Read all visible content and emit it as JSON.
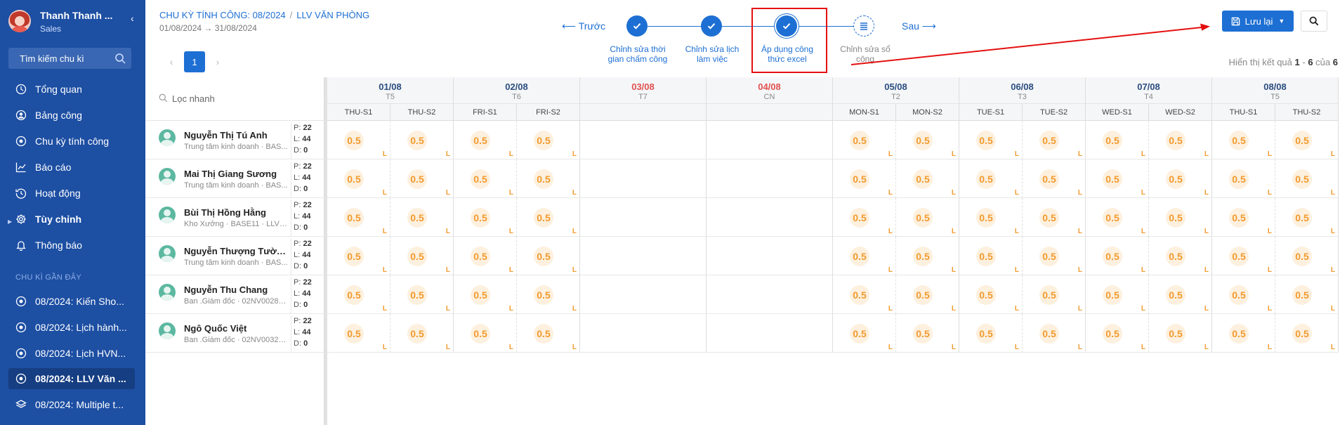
{
  "sidebar": {
    "user_name": "Thanh Thanh ...",
    "user_role": "Sales",
    "search_placeholder": "Tìm kiếm chu kì",
    "items": [
      {
        "label": "Tổng quan",
        "icon": "clock-icon"
      },
      {
        "label": "Bảng công",
        "icon": "user-circle-icon"
      },
      {
        "label": "Chu kỳ tính công",
        "icon": "radio-icon"
      },
      {
        "label": "Báo cáo",
        "icon": "chart-line-icon"
      },
      {
        "label": "Hoạt động",
        "icon": "history-icon"
      },
      {
        "label": "Tùy chỉnh",
        "icon": "gear-icon"
      },
      {
        "label": "Thông báo",
        "icon": "bell-icon"
      }
    ],
    "recent_label": "CHU KÌ GẦN ĐÂY",
    "recent": [
      {
        "label": "08/2024: Kiến Sho..."
      },
      {
        "label": "08/2024: Lịch hành..."
      },
      {
        "label": "08/2024: Lịch HVN..."
      },
      {
        "label": "08/2024: LLV Văn ..."
      },
      {
        "label": "08/2024: Multiple t..."
      }
    ]
  },
  "header": {
    "cycle": "CHU KỲ TÍNH CÔNG: 08/2024",
    "schedule": "LLV VĂN PHÒNG",
    "date_from": "01/08/2024",
    "date_to": "31/08/2024",
    "page": "1",
    "prev_label": "⟵ Trước",
    "next_label": "Sau ⟶"
  },
  "steps": [
    {
      "label": "Chỉnh sửa thời gian chấm công",
      "state": "done"
    },
    {
      "label": "Chỉnh sửa lịch làm việc",
      "state": "done"
    },
    {
      "label": "Áp dụng công thức excel",
      "state": "current"
    },
    {
      "label": "Chỉnh sửa sổ công",
      "state": "pending"
    }
  ],
  "toolbar": {
    "save_label": "Lưu lại",
    "result_prefix": "Hiển thị kết quả",
    "result_from": "1",
    "result_to": "6",
    "result_of": "của",
    "result_total": "6"
  },
  "grid": {
    "quick_filter_placeholder": "Lọc nhanh",
    "days": [
      {
        "date": "01/08",
        "weekday": "T5",
        "off": false,
        "shifts": [
          "THU-S1",
          "THU-S2"
        ]
      },
      {
        "date": "02/08",
        "weekday": "T6",
        "off": false,
        "shifts": [
          "FRI-S1",
          "FRI-S2"
        ]
      },
      {
        "date": "03/08",
        "weekday": "T7",
        "off": true,
        "shifts": []
      },
      {
        "date": "04/08",
        "weekday": "CN",
        "off": true,
        "shifts": []
      },
      {
        "date": "05/08",
        "weekday": "T2",
        "off": false,
        "shifts": [
          "MON-S1",
          "MON-S2"
        ]
      },
      {
        "date": "06/08",
        "weekday": "T3",
        "off": false,
        "shifts": [
          "TUE-S1",
          "TUE-S2"
        ]
      },
      {
        "date": "07/08",
        "weekday": "T4",
        "off": false,
        "shifts": [
          "WED-S1",
          "WED-S2"
        ]
      },
      {
        "date": "08/08",
        "weekday": "T5",
        "off": false,
        "shifts": [
          "THU-S1",
          "THU-S2"
        ]
      }
    ],
    "cell_value": "0.5",
    "cell_flag": "L",
    "employees": [
      {
        "name": "Nguyễn Thị Tú Anh",
        "dept": "Trung tâm kinh doanh · BAS...",
        "p": "22",
        "l": "44",
        "d": "0"
      },
      {
        "name": "Mai Thị Giang Sương",
        "dept": "Trung tâm kinh doanh · BAS...",
        "p": "22",
        "l": "44",
        "d": "0"
      },
      {
        "name": "Bùi Thị Hồng Hằng",
        "dept": "Kho Xưởng · BASE11 · LLV V...",
        "p": "22",
        "l": "44",
        "d": "0"
      },
      {
        "name": "Nguyễn Thượng Tường ...",
        "dept": "Trung tâm kinh doanh · BAS...",
        "p": "22",
        "l": "44",
        "d": "0"
      },
      {
        "name": "Nguyễn Thu Chang",
        "dept": "Ban .Giám đốc · 02NV0028 · ...",
        "p": "22",
        "l": "44",
        "d": "0"
      },
      {
        "name": "Ngô Quốc Việt",
        "dept": "Ban .Giám đốc · 02NV0032 · ...",
        "p": "22",
        "l": "44",
        "d": "0"
      }
    ]
  }
}
